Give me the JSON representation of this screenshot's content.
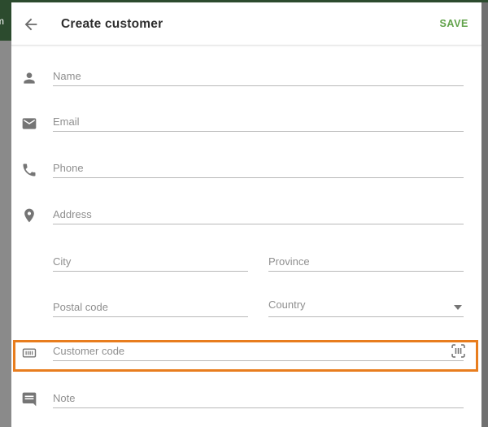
{
  "backdrop": {
    "partial_text": "m",
    "top_bar_color": "#2c4b2e",
    "dim_left_color": "#8a8a8a",
    "dim_right_color": "#707070"
  },
  "toolbar": {
    "title": "Create customer",
    "save_label": "SAVE",
    "back_icon": "arrow-back",
    "accent_color": "#61a24a"
  },
  "form": {
    "fields": {
      "name": {
        "placeholder": "Name",
        "icon": "person-icon",
        "value": ""
      },
      "email": {
        "placeholder": "Email",
        "icon": "email-icon",
        "value": ""
      },
      "phone": {
        "placeholder": "Phone",
        "icon": "phone-icon",
        "value": ""
      },
      "address": {
        "placeholder": "Address",
        "icon": "location-pin-icon",
        "value": ""
      },
      "city": {
        "placeholder": "City",
        "value": ""
      },
      "province": {
        "placeholder": "Province",
        "value": ""
      },
      "postal_code": {
        "placeholder": "Postal code",
        "value": ""
      },
      "country": {
        "placeholder": "Country",
        "icon": "dropdown-caret-icon",
        "value": ""
      },
      "customer_code": {
        "placeholder": "Customer code",
        "icon_left": "loyalty-card-barcode-icon",
        "icon_right": "barcode-scan-icon",
        "value": ""
      },
      "note": {
        "placeholder": "Note",
        "icon": "comment-icon",
        "value": ""
      }
    }
  },
  "annotation": {
    "highlight_target": "customer-code-row",
    "highlight_color": "#e87d1e"
  },
  "colors": {
    "field_underline": "#b9b9b9",
    "icon_gray": "#757575",
    "placeholder_gray": "#8f8f8f",
    "title_text": "#2e2e2e"
  }
}
